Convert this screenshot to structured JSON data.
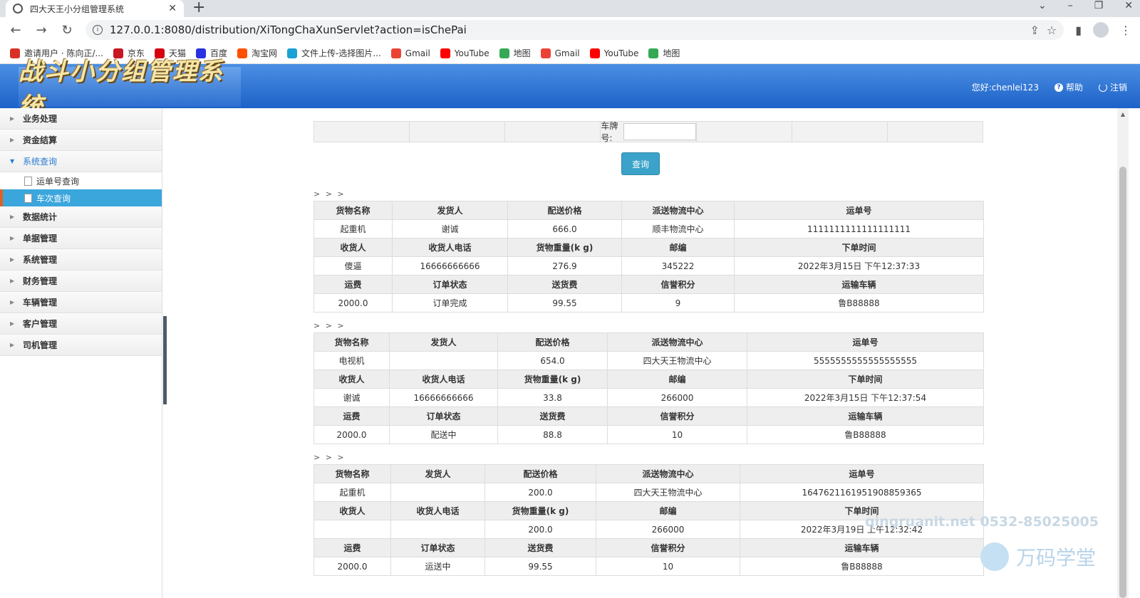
{
  "browser": {
    "tab_title": "四大天王小分组管理系统",
    "url": "127.0.0.1:8080/distribution/XiTongChaXunServlet?action=isChePai",
    "bookmarks": [
      {
        "label": "邀请用户 · 陈向正/...",
        "icon": "bookmark-red-icon",
        "color": "#d93025"
      },
      {
        "label": "京东",
        "icon": "jd-icon",
        "color": "#c81623"
      },
      {
        "label": "天猫",
        "icon": "tmall-icon",
        "color": "#d7000f"
      },
      {
        "label": "百度",
        "icon": "baidu-icon",
        "color": "#2932e1"
      },
      {
        "label": "淘宝网",
        "icon": "taobao-icon",
        "color": "#ff5000"
      },
      {
        "label": "文件上传-选择图片...",
        "icon": "upload-icon",
        "color": "#1aa1d6"
      },
      {
        "label": "Gmail",
        "icon": "gmail-icon",
        "color": "#ea4335"
      },
      {
        "label": "YouTube",
        "icon": "youtube-icon",
        "color": "#ff0000"
      },
      {
        "label": "地图",
        "icon": "maps-icon",
        "color": "#34a853"
      },
      {
        "label": "Gmail",
        "icon": "gmail-icon",
        "color": "#ea4335"
      },
      {
        "label": "YouTube",
        "icon": "youtube-icon",
        "color": "#ff0000"
      },
      {
        "label": "地图",
        "icon": "maps-icon",
        "color": "#34a853"
      }
    ]
  },
  "header": {
    "logo_text": "战斗小分组管理系统",
    "greeting": "您好:chenlei123",
    "help": "帮助",
    "logout": "注销"
  },
  "sidebar": {
    "menu_before": [
      "业务处理",
      "资金结算"
    ],
    "open_menu": "系统查询",
    "sub_items": [
      "运单号查询",
      "车次查询"
    ],
    "menu_after": [
      "数据统计",
      "单据管理",
      "系统管理",
      "财务管理",
      "车辆管理",
      "客户管理",
      "司机管理"
    ]
  },
  "search": {
    "plate_label": "车牌号:",
    "plate_value": "",
    "query_button": "查询"
  },
  "results": [
    {
      "marker": "> > >",
      "rows": [
        [
          "货物名称",
          "发货人",
          "配送价格",
          "派送物流中心",
          "运单号"
        ],
        [
          "起重机",
          "谢诚",
          "666.0",
          "顺丰物流中心",
          "1111111111111111111"
        ],
        [
          "收货人",
          "收货人电话",
          "货物重量(k g)",
          "邮编",
          "下单时间"
        ],
        [
          "傻逼",
          "16666666666",
          "276.9",
          "345222",
          "2022年3月15日 下午12:37:33"
        ],
        [
          "运费",
          "订单状态",
          "送货费",
          "信誉积分",
          "运输车辆"
        ],
        [
          "2000.0",
          "订单完成",
          "99.55",
          "9",
          "鲁B88888"
        ]
      ]
    },
    {
      "marker": "> > >",
      "rows": [
        [
          "货物名称",
          "发货人",
          "配送价格",
          "派送物流中心",
          "运单号"
        ],
        [
          "电视机",
          "",
          "654.0",
          "四大天王物流中心",
          "5555555555555555555"
        ],
        [
          "收货人",
          "收货人电话",
          "货物重量(k g)",
          "邮编",
          "下单时间"
        ],
        [
          "谢诚",
          "16666666666",
          "33.8",
          "266000",
          "2022年3月15日 下午12:37:54"
        ],
        [
          "运费",
          "订单状态",
          "送货费",
          "信誉积分",
          "运输车辆"
        ],
        [
          "2000.0",
          "配送中",
          "88.8",
          "10",
          "鲁B88888"
        ]
      ]
    },
    {
      "marker": "> > >",
      "rows": [
        [
          "货物名称",
          "发货人",
          "配送价格",
          "派送物流中心",
          "运单号"
        ],
        [
          "起重机",
          "",
          "200.0",
          "四大天王物流中心",
          "1647621161951908859365"
        ],
        [
          "收货人",
          "收货人电话",
          "货物重量(k g)",
          "邮编",
          "下单时间"
        ],
        [
          "",
          "",
          "200.0",
          "266000",
          "2022年3月19日 上午12:32:42"
        ],
        [
          "运费",
          "订单状态",
          "送货费",
          "信誉积分",
          "运输车辆"
        ],
        [
          "2000.0",
          "运送中",
          "99.55",
          "10",
          "鲁B88888"
        ]
      ]
    }
  ],
  "watermark": {
    "line1": "qingruanit.net 0532-85025005",
    "line2": "万码学堂"
  }
}
